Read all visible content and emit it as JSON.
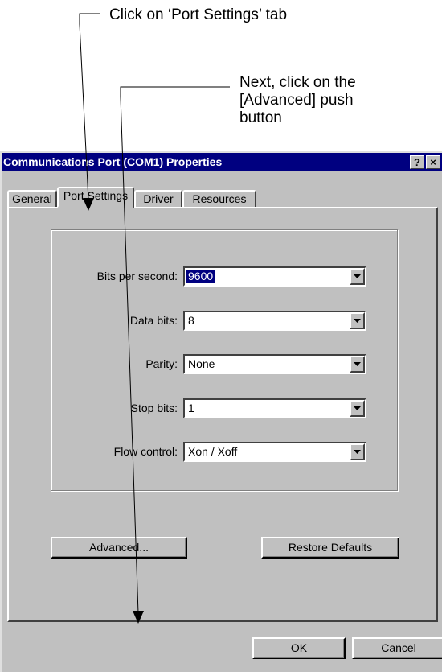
{
  "annotations": {
    "step1": "Click on ‘Port Settings’ tab",
    "step2_line1": "Next, click on the",
    "step2_line2": "[Advanced] push",
    "step2_line3": "button"
  },
  "window": {
    "title": "Communications Port (COM1) Properties",
    "help_glyph": "?",
    "close_glyph": "×"
  },
  "tabs": [
    {
      "label": "General",
      "active": false
    },
    {
      "label": "Port Settings",
      "active": true
    },
    {
      "label": "Driver",
      "active": false
    },
    {
      "label": "Resources",
      "active": false
    }
  ],
  "fields": [
    {
      "label": "Bits per second:",
      "value": "9600",
      "selected": true
    },
    {
      "label": "Data bits:",
      "value": "8"
    },
    {
      "label": "Parity:",
      "value": "None"
    },
    {
      "label": "Stop bits:",
      "value": "1"
    },
    {
      "label": "Flow control:",
      "value": "Xon / Xoff"
    }
  ],
  "buttons": {
    "advanced": "Advanced...",
    "restore_defaults": "Restore Defaults",
    "ok": "OK",
    "cancel": "Cancel"
  },
  "icons": {
    "dropdown": "chevron-down-icon",
    "arrow": "arrow-pointer-icon"
  }
}
